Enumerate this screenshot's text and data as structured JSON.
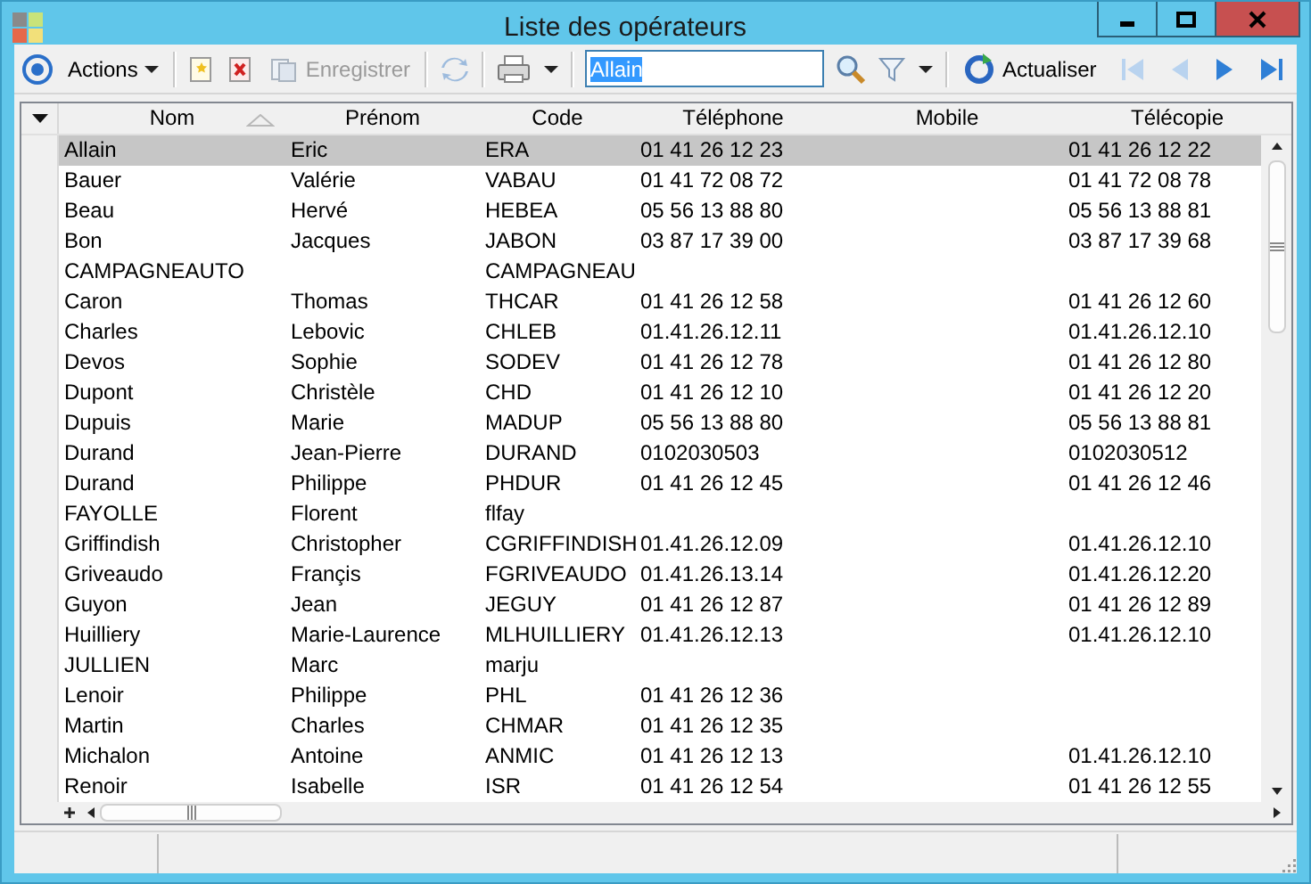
{
  "window": {
    "title": "Liste des opérateurs"
  },
  "toolbar": {
    "actions": {
      "label": "Actions"
    },
    "save": {
      "label": "Enregistrer",
      "disabled": true
    },
    "sync": {
      "disabled": true
    },
    "search": {
      "value": "Allain",
      "highlighted": true
    },
    "refresh": {
      "label": "Actualiser"
    },
    "nav": [
      {
        "disabled": true
      },
      {
        "disabled": true
      },
      {
        "disabled": false
      },
      {
        "disabled": false
      }
    ]
  },
  "table": {
    "columns": [
      {
        "label": "Nom",
        "sorted": true
      },
      {
        "label": "Prénom",
        "sorted": false
      },
      {
        "label": "Code",
        "sorted": false
      },
      {
        "label": "Téléphone",
        "sorted": false
      },
      {
        "label": "Mobile",
        "sorted": false
      },
      {
        "label": "Télécopie",
        "sorted": false
      }
    ],
    "rows": [
      {
        "selected": true,
        "cells": [
          "Allain",
          "Eric",
          "ERA",
          "01 41 26 12 23",
          "",
          "01 41 26 12 22"
        ]
      },
      {
        "selected": false,
        "cells": [
          "Bauer",
          "Valérie",
          "VABAU",
          "01 41 72 08 72",
          "",
          "01 41 72 08 78"
        ]
      },
      {
        "selected": false,
        "cells": [
          "Beau",
          "Hervé",
          "HEBEA",
          "05 56 13 88 80",
          "",
          "05 56 13 88 81"
        ]
      },
      {
        "selected": false,
        "cells": [
          "Bon",
          "Jacques",
          "JABON",
          "03 87 17 39 00",
          "",
          "03 87 17 39 68"
        ]
      },
      {
        "selected": false,
        "cells": [
          "CAMPAGNEAUTO",
          "",
          "CAMPAGNEAU",
          "",
          "",
          ""
        ]
      },
      {
        "selected": false,
        "cells": [
          "Caron",
          "Thomas",
          "THCAR",
          "01 41 26 12 58",
          "",
          "01 41 26 12 60"
        ]
      },
      {
        "selected": false,
        "cells": [
          "Charles",
          "Lebovic",
          "CHLEB",
          "01.41.26.12.11",
          "",
          "01.41.26.12.10"
        ]
      },
      {
        "selected": false,
        "cells": [
          "Devos",
          "Sophie",
          "SODEV",
          "01 41 26 12 78",
          "",
          "01 41 26 12 80"
        ]
      },
      {
        "selected": false,
        "cells": [
          "Dupont",
          "Christèle",
          "CHD",
          "01 41 26 12 10",
          "",
          "01 41 26 12 20"
        ]
      },
      {
        "selected": false,
        "cells": [
          "Dupuis",
          "Marie",
          "MADUP",
          "05 56 13 88 80",
          "",
          "05 56 13 88 81"
        ]
      },
      {
        "selected": false,
        "cells": [
          "Durand",
          "Jean-Pierre",
          "DURAND",
          "0102030503",
          "",
          "0102030512"
        ]
      },
      {
        "selected": false,
        "cells": [
          "Durand",
          "Philippe",
          "PHDUR",
          "01 41 26 12 45",
          "",
          "01 41 26 12 46"
        ]
      },
      {
        "selected": false,
        "cells": [
          "FAYOLLE",
          "Florent",
          "flfay",
          "",
          "",
          ""
        ]
      },
      {
        "selected": false,
        "cells": [
          "Griffindish",
          "Christopher",
          "CGRIFFINDISH",
          "01.41.26.12.09",
          "",
          "01.41.26.12.10"
        ]
      },
      {
        "selected": false,
        "cells": [
          "Griveaudo",
          "Françis",
          "FGRIVEAUDO",
          "01.41.26.13.14",
          "",
          "01.41.26.12.20"
        ]
      },
      {
        "selected": false,
        "cells": [
          "Guyon",
          "Jean",
          "JEGUY",
          "01 41 26 12 87",
          "",
          "01 41 26 12 89"
        ]
      },
      {
        "selected": false,
        "cells": [
          "Huilliery",
          "Marie-Laurence",
          "MLHUILLIERY",
          "01.41.26.12.13",
          "",
          "01.41.26.12.10"
        ]
      },
      {
        "selected": false,
        "cells": [
          "JULLIEN",
          "Marc",
          "marju",
          "",
          "",
          ""
        ]
      },
      {
        "selected": false,
        "cells": [
          "Lenoir",
          "Philippe",
          "PHL",
          "01 41 26 12 36",
          "",
          ""
        ]
      },
      {
        "selected": false,
        "cells": [
          "Martin",
          "Charles",
          "CHMAR",
          "01 41 26 12 35",
          "",
          ""
        ]
      },
      {
        "selected": false,
        "cells": [
          "Michalon",
          "Antoine",
          "ANMIC",
          "01 41 26 12 13",
          "",
          "01.41.26.12.10"
        ]
      },
      {
        "selected": false,
        "cells": [
          "Renoir",
          "Isabelle",
          "ISR",
          "01 41 26 12 54",
          "",
          "01 41 26 12 55"
        ]
      }
    ]
  }
}
